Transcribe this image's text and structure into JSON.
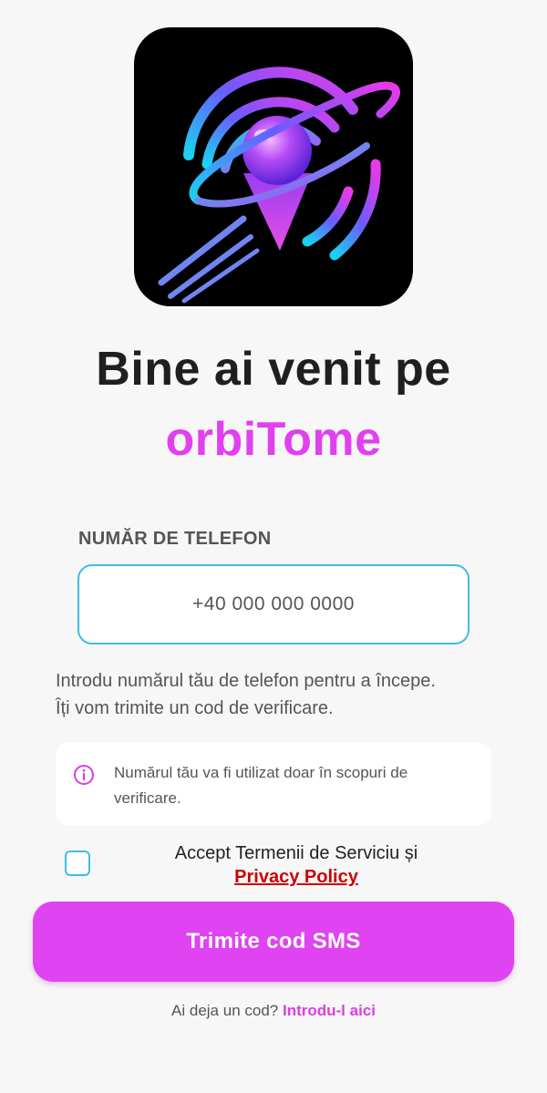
{
  "app": {
    "name": "orbiTome"
  },
  "logo": {
    "icon": "orbit-location-pin-icon"
  },
  "welcome": {
    "line1": "Bine ai venit pe",
    "brand": "orbiTome"
  },
  "phone": {
    "label": "NUMĂR DE TELEFON",
    "placeholder": "+40 000 000 0000",
    "value": ""
  },
  "helper": {
    "line1": "Introdu numărul tău de telefon pentru a începe.",
    "line2": "Îți vom trimite un cod de verificare."
  },
  "notice": {
    "icon": "info-icon",
    "text": "Numărul tău va fi utilizat doar în scopuri de verificare."
  },
  "terms": {
    "checked": false,
    "text": "Accept Termenii de Serviciu și",
    "link": "Privacy Policy"
  },
  "submit": {
    "label": "Trimite cod SMS"
  },
  "footer": {
    "question": "Ai deja un cod?",
    "link": "Introdu-l aici"
  },
  "colors": {
    "accent": "#e040ef",
    "input_border": "#3fbde3",
    "link_red": "#cc0000",
    "background": "#f7f7f7"
  }
}
